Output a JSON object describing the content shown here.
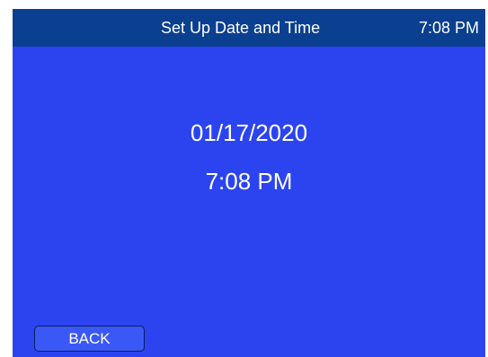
{
  "header": {
    "title": "Set Up Date and Time",
    "clock": "7:08 PM"
  },
  "main": {
    "date": "01/17/2020",
    "time": "7:08 PM"
  },
  "footer": {
    "back_label": "BACK"
  },
  "colors": {
    "screen_background": "#2b44f0",
    "header_background": "#0b3f8f",
    "text": "#ffffff"
  }
}
